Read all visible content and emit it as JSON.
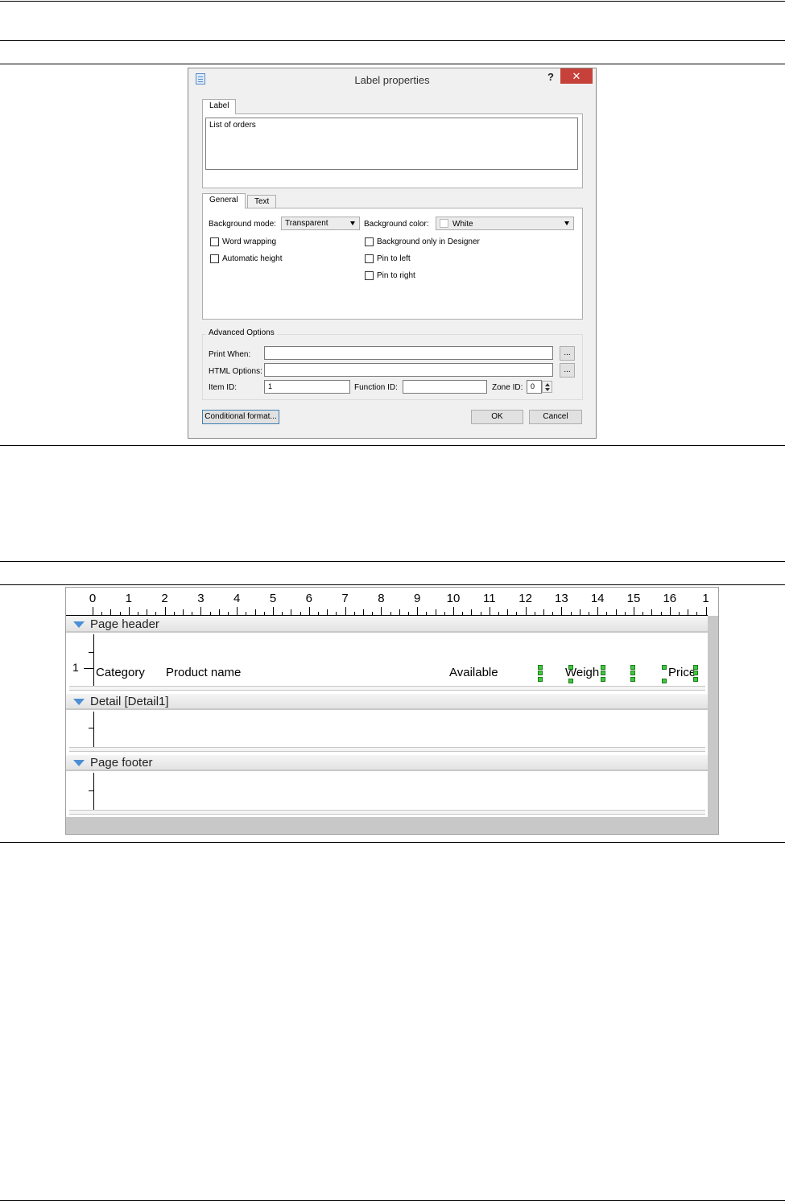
{
  "dialog": {
    "title": "Label properties",
    "help": "?",
    "close": "✕",
    "top_tab": "Label",
    "label_text": "List of orders",
    "tabs": [
      "General",
      "Text"
    ],
    "general": {
      "background_mode_label": "Background mode:",
      "background_mode_value": "Transparent",
      "background_color_label": "Background color:",
      "background_color_value": "White",
      "word_wrapping": "Word wrapping",
      "automatic_height": "Automatic height",
      "background_only_designer": "Background only in Designer",
      "pin_left": "Pin to left",
      "pin_right": "Pin to right"
    },
    "advanced": {
      "title": "Advanced Options",
      "print_when_label": "Print When:",
      "print_when_value": "",
      "html_options_label": "HTML Options:",
      "html_options_value": "",
      "browse": "...",
      "item_id_label": "Item ID:",
      "item_id_value": "1",
      "function_id_label": "Function ID:",
      "function_id_value": "",
      "zone_id_label": "Zone ID:",
      "zone_id_value": "0"
    },
    "buttons": {
      "conditional": "Conditional format...",
      "ok": "OK",
      "cancel": "Cancel"
    }
  },
  "designer": {
    "ruler": [
      "0",
      "1",
      "2",
      "3",
      "4",
      "5",
      "6",
      "7",
      "8",
      "9",
      "10",
      "11",
      "12",
      "13",
      "14",
      "15",
      "16",
      "1"
    ],
    "bands": {
      "page_header": "Page header",
      "detail": "Detail [Detail1]",
      "page_footer": "Page footer"
    },
    "vruler_number": "1",
    "fields": [
      "Category",
      "Product name",
      "Available",
      "Weigh",
      "Price"
    ]
  }
}
